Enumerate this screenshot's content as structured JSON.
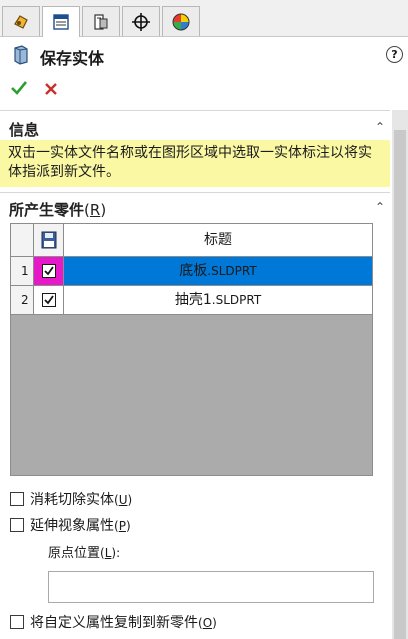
{
  "tabs": [
    {
      "name": "featuremanager-tab",
      "icon": "feature-manager-icon"
    },
    {
      "name": "propertymanager-tab",
      "icon": "property-manager-icon"
    },
    {
      "name": "configurationmanager-tab",
      "icon": "configuration-manager-icon"
    },
    {
      "name": "dimxpert-tab",
      "icon": "crosshair-icon"
    },
    {
      "name": "display-manager-tab",
      "icon": "appearance-icon"
    }
  ],
  "panel": {
    "title": "保存实体",
    "help": "?"
  },
  "actions": {
    "ok": "✓",
    "cancel": "✕"
  },
  "info_section": {
    "title": "信息",
    "text": "双击一实体文件名称或在图形区域中选取一实体标注以将实体指派到新文件。"
  },
  "parts_section": {
    "title": "所产生零件",
    "mnemonic": "R",
    "column_header": "标题",
    "rows": [
      {
        "num": "1",
        "name": "底板",
        "ext": ".SLDPRT",
        "checked": true,
        "selected": true
      },
      {
        "num": "2",
        "name": "抽壳1",
        "ext": ".SLDPRT",
        "checked": true,
        "selected": false
      }
    ]
  },
  "options": {
    "consume_cut": {
      "label": "消耗切除实体",
      "mnemonic": "U",
      "checked": false
    },
    "propagate_visual": {
      "label": "延伸视象属性",
      "mnemonic": "P",
      "checked": false
    },
    "origin_label": "原点位置",
    "origin_mnemonic": "L",
    "origin_value": "",
    "copy_custom": {
      "label": "将自定义属性复制到新零件",
      "mnemonic": "O",
      "checked": false
    }
  },
  "colors": {
    "info_bg": "#fbf8a3",
    "selected_row": "#0078d7",
    "selected_check": "#e619c9",
    "ok_green": "#2e9e2e",
    "cancel_red": "#c9302c"
  }
}
